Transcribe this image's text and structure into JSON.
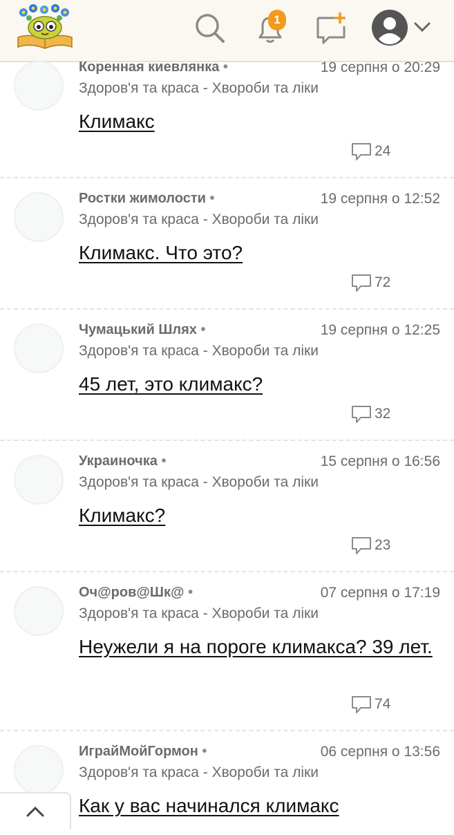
{
  "header": {
    "logo": "flower-book-logo",
    "icons": [
      "search-icon",
      "bell-icon",
      "add-post-icon",
      "user-avatar-icon",
      "chevron-down-icon"
    ],
    "notifications_count": "1",
    "badge_color": "#f39a1c"
  },
  "posts": [
    {
      "author": "Коренная киевлянка",
      "date": "19 серпня о 20:29",
      "category": "Здоров'я та краса - Хвороби та ліки",
      "title": "Климакс",
      "comments": "24"
    },
    {
      "author": "Ростки жимолости",
      "date": "19 серпня о 12:52",
      "category": "Здоров'я та краса - Хвороби та ліки",
      "title": "Климакс. Что это?",
      "comments": "72"
    },
    {
      "author": "Чумацький Шлях",
      "date": "19 серпня о 12:25",
      "category": "Здоров'я та краса - Хвороби та ліки",
      "title": "45 лет, это климакс?",
      "comments": "32"
    },
    {
      "author": "Украиночка",
      "date": "15 серпня о 16:56",
      "category": "Здоров'я та краса - Хвороби та ліки",
      "title": "Климакс?",
      "comments": "23"
    },
    {
      "author": "Оч@ров@Шк@",
      "date": "07 серпня о 17:19",
      "category": "Здоров'я та краса - Хвороби та ліки",
      "title": "Неужели я на пороге климакса? 39 лет.",
      "comments": "74"
    },
    {
      "author": "ИграйМойГормон",
      "date": "06 серпня о 13:56",
      "category": "Здоров'я та краса - Хвороби та ліки",
      "title": "Как у вас начинался климакс",
      "comments": ""
    }
  ],
  "scroll_top_icon": "chevron-up-icon"
}
